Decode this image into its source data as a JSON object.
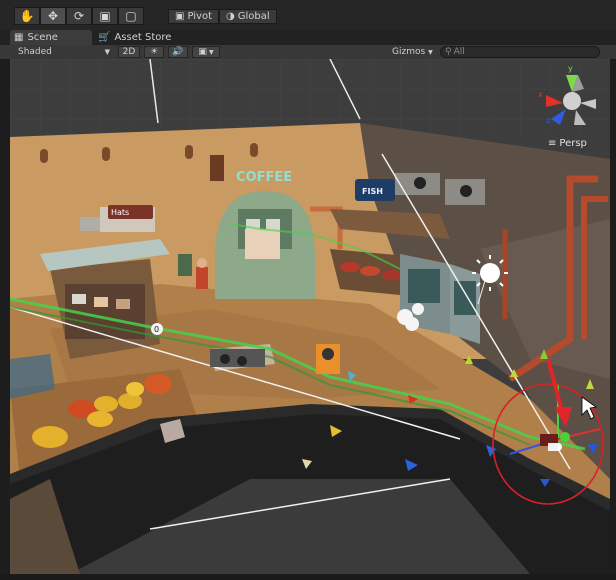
{
  "toolbar": {
    "tools": [
      "hand-tool",
      "move-tool",
      "rotate-tool",
      "scale-tool",
      "rect-tool"
    ],
    "pivot_label": "Pivot",
    "global_label": "Global"
  },
  "tabs": [
    {
      "label": "Scene",
      "icon": "scene-grid-icon"
    },
    {
      "label": "Asset Store",
      "icon": "asset-store-icon"
    }
  ],
  "scene_toolbar": {
    "shading_mode": "Shaded",
    "mode_2d": "2D",
    "gizmos_label": "Gizmos",
    "search_placeholder": "All"
  },
  "viewport": {
    "projection_label": "Persp",
    "axis_labels": {
      "x": "x",
      "y": "y",
      "z": "z"
    },
    "signs": {
      "coffee": "COFFEE",
      "fish": "FISH",
      "hat": "Hats"
    },
    "light_probe_badge": "0"
  },
  "colors": {
    "editor_bg": "#262626",
    "selection_circle": "#d8202a",
    "arrow": "#e0242a",
    "floor": "#b07f4a"
  }
}
